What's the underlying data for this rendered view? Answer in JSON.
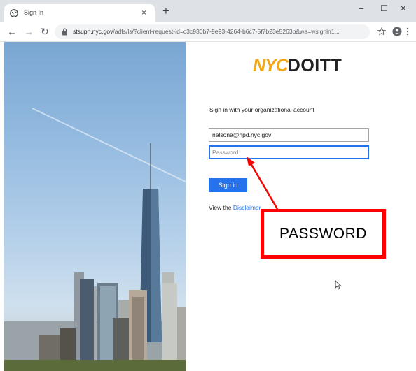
{
  "browser": {
    "tab": {
      "title": "Sign In",
      "close": "×",
      "icon": "globe-icon"
    },
    "new_tab": "+",
    "window_controls": {
      "minimize": "–",
      "maximize": "☐",
      "close": "×"
    },
    "nav": {
      "back": "←",
      "forward": "→",
      "reload": "↻"
    },
    "url": {
      "host": "stsupn.nyc.gov",
      "path": "/adfs/ls/?client-request-id=c3c930b7-9e93-4264-b6c7-5f7b23e5263b&wa=wsignin1..."
    },
    "toolbar_icons": [
      "star-icon",
      "account-icon",
      "menu-icon"
    ]
  },
  "login": {
    "logo_nyc": "NYC",
    "logo_doitt": "DOITT",
    "heading": "Sign in with your organizational account",
    "email_value": "nelsona@hpd.nyc.gov",
    "password_placeholder": "Password",
    "signin_label": "Sign in",
    "disclaimer_prefix": "View the ",
    "disclaimer_link": "Disclaimer",
    "disclaimer_suffix": "."
  },
  "annotation": {
    "label": "PASSWORD",
    "color": "#ff0000"
  },
  "colors": {
    "accent": "#2672ec",
    "logo_orange": "#f0a818"
  }
}
